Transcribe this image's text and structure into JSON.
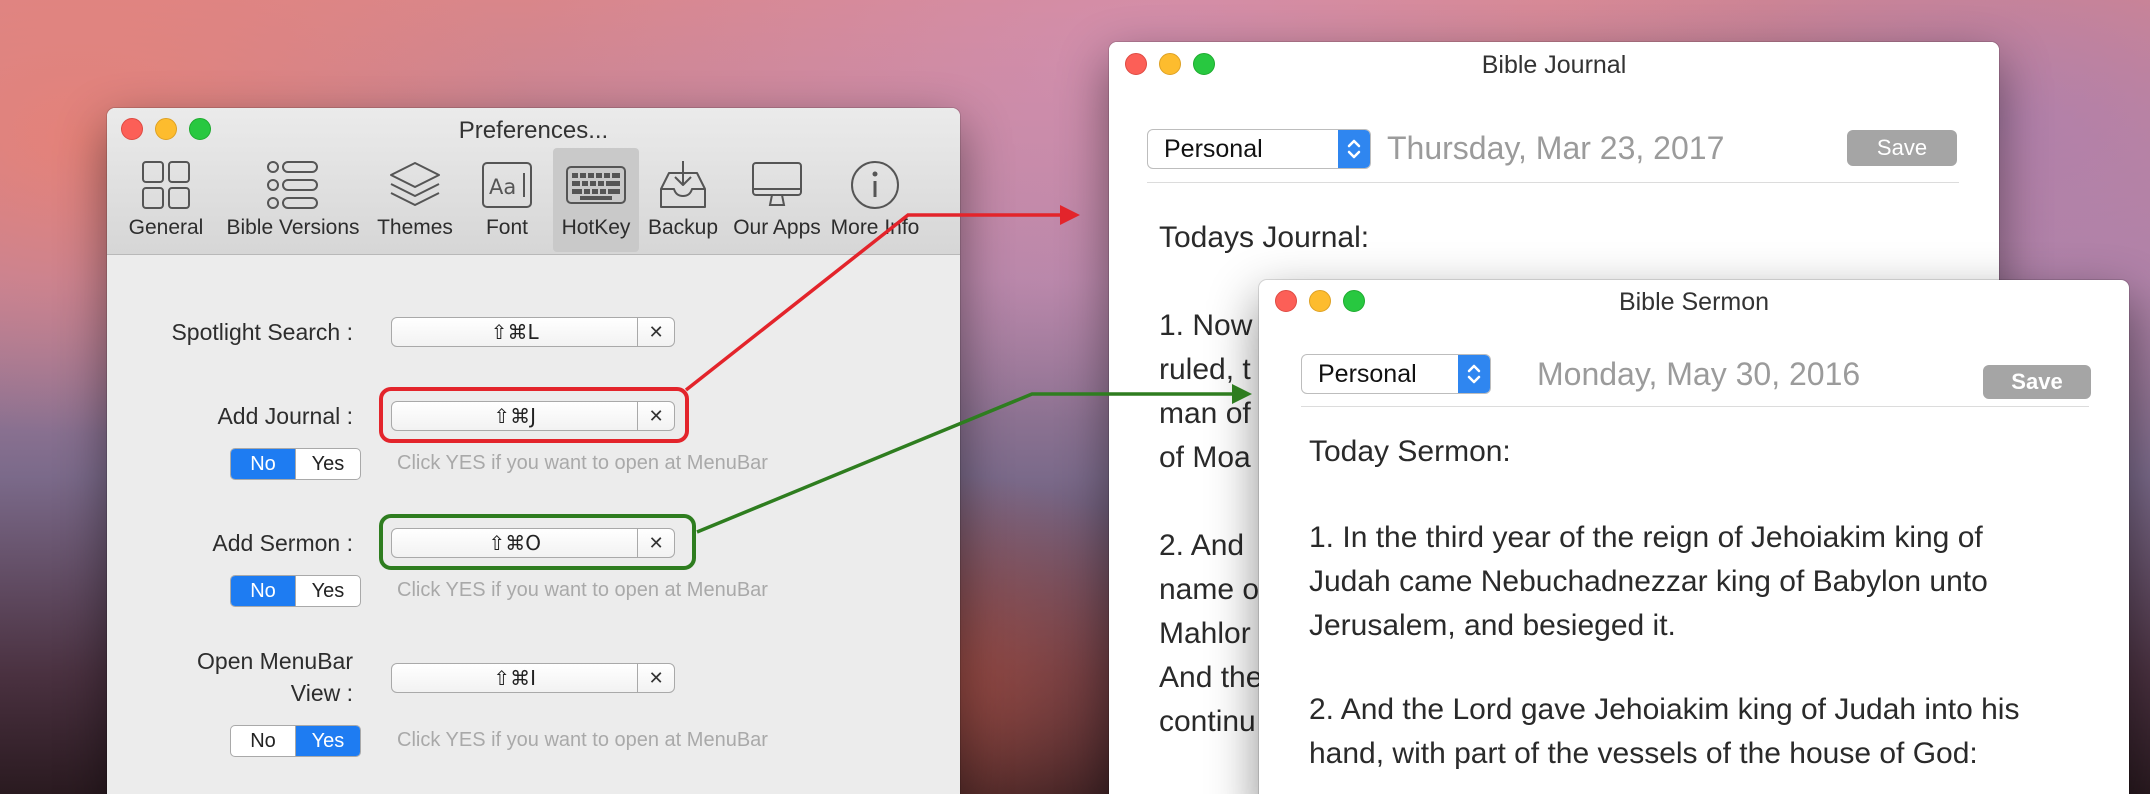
{
  "preferences": {
    "title": "Preferences...",
    "toolbar": [
      {
        "label": "General",
        "icon": "grid-icon"
      },
      {
        "label": "Bible Versions",
        "icon": "list-icon"
      },
      {
        "label": "Themes",
        "icon": "layers-icon"
      },
      {
        "label": "Font",
        "icon": "font-icon"
      },
      {
        "label": "HotKey",
        "icon": "keyboard-icon",
        "active": true
      },
      {
        "label": "Backup",
        "icon": "download-tray-icon"
      },
      {
        "label": "Our Apps",
        "icon": "monitor-icon"
      },
      {
        "label": "More Info",
        "icon": "info-icon"
      }
    ],
    "rows": {
      "spotlight": {
        "label": "Spotlight Search :",
        "hotkey": "⇧⌘L"
      },
      "journal": {
        "label": "Add Journal :",
        "hotkey": "⇧⌘J",
        "no": "No",
        "yes": "Yes",
        "selected": "No",
        "hint": "Click YES if you want to open at MenuBar"
      },
      "sermon": {
        "label": "Add Sermon :",
        "hotkey": "⇧⌘O",
        "no": "No",
        "yes": "Yes",
        "selected": "No",
        "hint": "Click YES if you want to open at MenuBar"
      },
      "menubar": {
        "label_line1": "Open MenuBar",
        "label_line2": "View :",
        "hotkey": "⇧⌘I",
        "no": "No",
        "yes": "Yes",
        "selected": "Yes",
        "hint": "Click YES if you want to open at MenuBar"
      }
    },
    "clear_glyph": "✕"
  },
  "journal_window": {
    "title": "Bible Journal",
    "category": "Personal",
    "date": "Thursday, Mar 23, 2017",
    "save": "Save",
    "heading": "Todays Journal:",
    "body_lines": [
      "1. Now",
      "ruled, t",
      "man of",
      "of Moa",
      "",
      "2. And",
      "name o",
      "Mahlor",
      "And the",
      "continu"
    ]
  },
  "sermon_window": {
    "title": "Bible Sermon",
    "category": "Personal",
    "date": "Monday, May 30, 2016",
    "save": "Save",
    "heading": "Today Sermon:",
    "para1": "1. In the third year of the reign of Jehoiakim king of\nJudah came Nebuchadnezzar king of Babylon unto\nJerusalem, and besieged it.",
    "para2": "2. And the Lord gave Jehoiakim king of Judah into his\nhand, with part of the vessels of the house of God:"
  },
  "colors": {
    "highlight_red": "#e3242b",
    "highlight_green": "#2e7d1f",
    "segment_selected": "#1e7cf2",
    "save_button": "#a5a5a5"
  }
}
